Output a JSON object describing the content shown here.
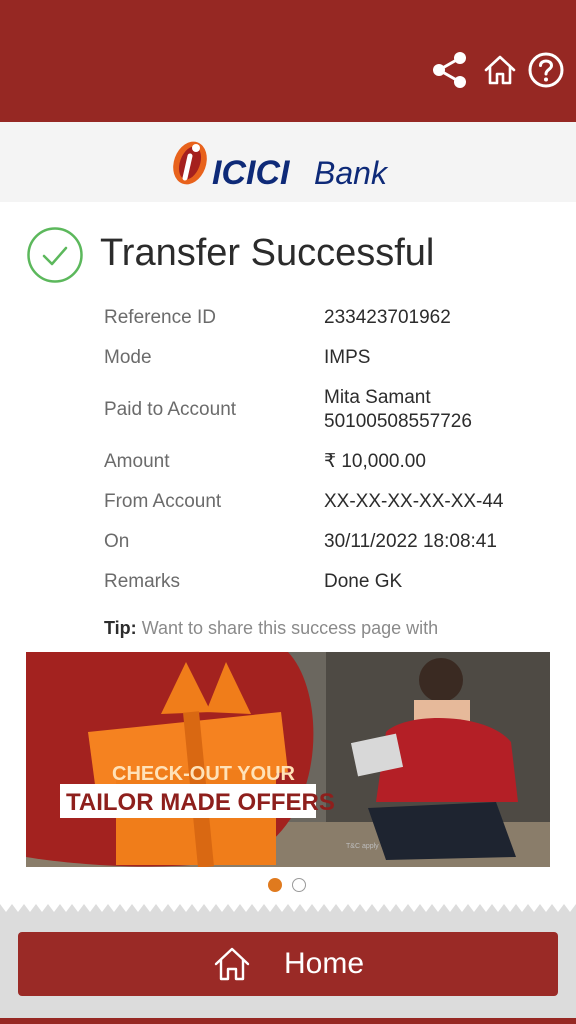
{
  "header": {
    "share_icon": "share-icon",
    "home_icon": "home-icon",
    "help_icon": "help-icon"
  },
  "brand": {
    "name_icici": "ICICI",
    "name_bank": "Bank"
  },
  "status": {
    "title": "Transfer Successful",
    "icon": "check-circle-icon"
  },
  "details": [
    {
      "label": "Reference ID",
      "value": "233423701962"
    },
    {
      "label": "Mode",
      "value": "IMPS"
    },
    {
      "label": "Paid to Account",
      "value": "Mita Samant",
      "value2": "50100508557726"
    },
    {
      "label": "Amount",
      "value": "₹ 10,000.00"
    },
    {
      "label": "From Account",
      "value": "XX-XX-XX-XX-XX-44"
    },
    {
      "label": "On",
      "value": "30/11/2022 18:08:41"
    },
    {
      "label": "Remarks",
      "value": "Done GK"
    }
  ],
  "tip": {
    "prefix": "Tip:",
    "text": "Want to share this success page with"
  },
  "banner": {
    "line1": "CHECK-OUT YOUR",
    "line2": "TAILOR MADE OFFERS",
    "small": "T&C apply"
  },
  "carousel": {
    "active_index": 0,
    "count": 2
  },
  "footer": {
    "home_label": "Home"
  },
  "colors": {
    "brand_red": "#962823",
    "accent_orange": "#e07a1e",
    "success_green": "#5cb85c"
  }
}
